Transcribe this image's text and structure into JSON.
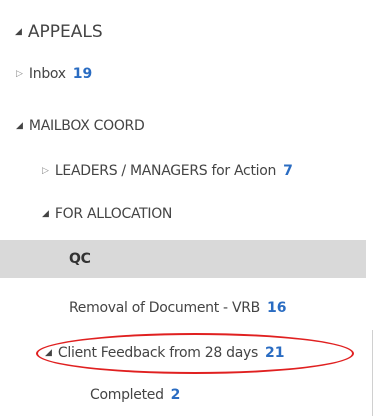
{
  "folders": [
    {
      "id": "appeals",
      "label": "APPEALS",
      "count": null,
      "expanded": true
    },
    {
      "id": "inbox",
      "label": "Inbox",
      "count": "19",
      "expanded": false
    },
    {
      "id": "mailbox-coord",
      "label": "MAILBOX COORD",
      "count": null,
      "expanded": true
    },
    {
      "id": "leaders-managers",
      "label": "LEADERS / MANAGERS for Action",
      "count": "7",
      "expanded": false
    },
    {
      "id": "for-allocation",
      "label": "FOR ALLOCATION",
      "count": null,
      "expanded": true
    },
    {
      "id": "qc",
      "label": "QC",
      "count": null,
      "selected": true
    },
    {
      "id": "removal-of-document",
      "label": "Removal of Document - VRB",
      "count": "16"
    },
    {
      "id": "client-feedback",
      "label": "Client Feedback from 28 days",
      "count": "21",
      "expanded": true,
      "circled": true
    },
    {
      "id": "completed",
      "label": "Completed",
      "count": "2"
    }
  ],
  "icons": {
    "expanded": "◢",
    "collapsed": "▷"
  },
  "colors": {
    "unread_count": "#2a6cc2",
    "selected_background": "#d9d9d9",
    "annotation_ellipse": "#e02020"
  }
}
